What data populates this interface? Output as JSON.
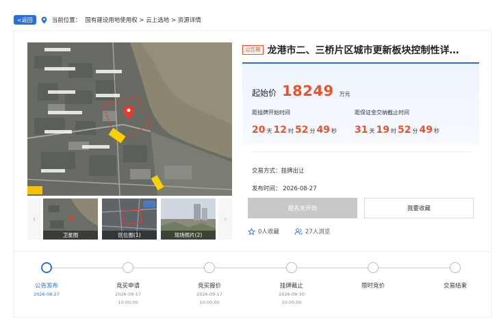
{
  "breadcrumb": {
    "back_label": "<返回",
    "location_label": "当前位置：",
    "path": "国有建设用地使用权 > 云上选地 > 资源详情"
  },
  "gallery": {
    "main_overlay_text": "",
    "thumbnails": [
      {
        "label": "卫星图"
      },
      {
        "label": "区位图(1)"
      },
      {
        "label": "现场照片(2)"
      }
    ]
  },
  "listing": {
    "status_tag": "公告期",
    "title": "龙港市二、三桥片区城市更新板块控制性详…",
    "start_price_label": "起始价",
    "start_price_value": "18249",
    "start_price_unit": "万元",
    "countdown_listing": {
      "label": "距挂牌开始时间",
      "days": "20",
      "day_unit": "天",
      "hours": "12",
      "hour_unit": "时",
      "minutes": "52",
      "minute_unit": "分",
      "seconds": "49",
      "second_unit": "秒"
    },
    "countdown_deposit": {
      "label": "距保证金交纳截止时间",
      "days": "31",
      "day_unit": "天",
      "hours": "19",
      "hour_unit": "时",
      "minutes": "52",
      "minute_unit": "分",
      "seconds": "49",
      "second_unit": "秒"
    },
    "trade_method": "交易方式：挂牌出让",
    "publish_time": "发布时间： 2026-08-27",
    "register_button": "报名未开始",
    "favorite_button": "我要收藏",
    "favorites_count": "0人收藏",
    "views_count": "27人浏览"
  },
  "timeline": {
    "steps": [
      {
        "name": "公告发布",
        "date": "2026-08-27",
        "time": "",
        "active": true
      },
      {
        "name": "竞买申请",
        "date": "2026-09-17",
        "time": "10:00:00",
        "active": false
      },
      {
        "name": "竞买报价",
        "date": "2026-09-17",
        "time": "10:00:00",
        "active": false
      },
      {
        "name": "挂牌截止",
        "date": "2026-09-30",
        "time": "10:00:00",
        "active": false
      },
      {
        "name": "限时竞价",
        "date": "",
        "time": "",
        "active": false
      },
      {
        "name": "交易结束",
        "date": "",
        "time": "",
        "active": false
      }
    ]
  },
  "colors": {
    "accent": "#2b6fd6",
    "price": "#e8532b",
    "disabled_button": "#c8c8c8"
  }
}
